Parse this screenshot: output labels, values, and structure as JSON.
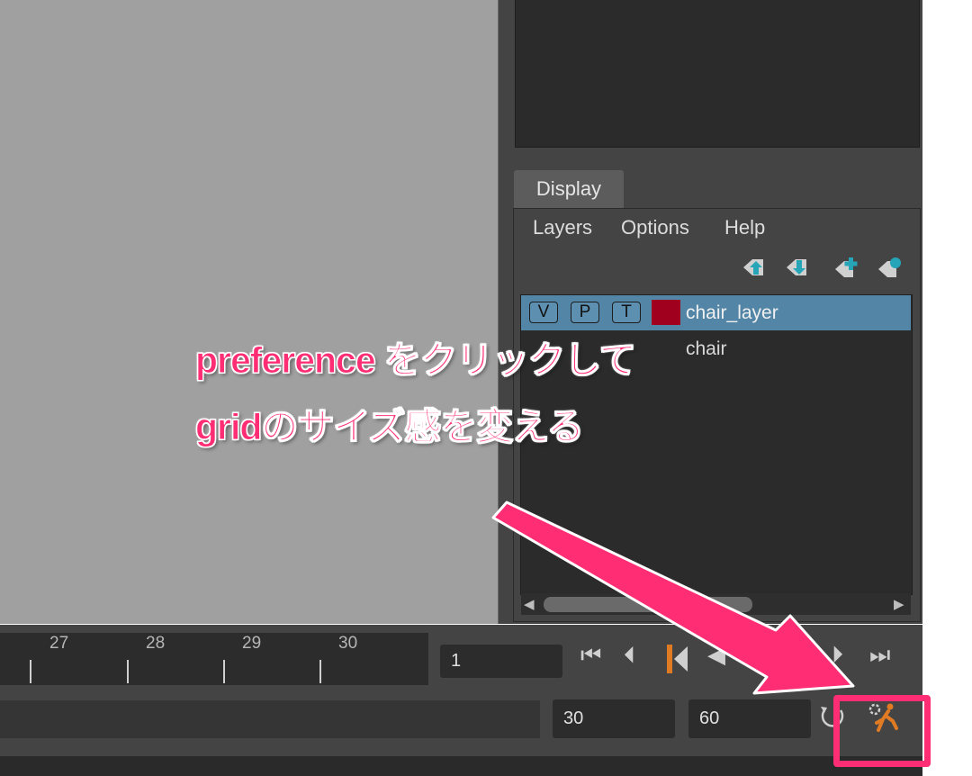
{
  "display_panel": {
    "tab_label": "Display",
    "menu": [
      "Layers",
      "Options",
      "Help"
    ],
    "toolbar_icons": [
      "move-layer-up-icon",
      "move-layer-down-icon",
      "new-layer-icon",
      "new-layer-selected-icon"
    ],
    "layer": {
      "visibility_label": "V",
      "playback_label": "P",
      "template_label": "T",
      "color": "#a0001e",
      "name": "chair_layer",
      "child_fragment": "chair"
    }
  },
  "timeline": {
    "frame_labels": [
      "27",
      "28",
      "29",
      "30"
    ],
    "current_frame": "1",
    "range_start": "30",
    "range_end": "60"
  },
  "annotation": {
    "line1": "preference をクリックして",
    "line2": "gridのサイズ感を変える",
    "color": "#ff2e74"
  }
}
